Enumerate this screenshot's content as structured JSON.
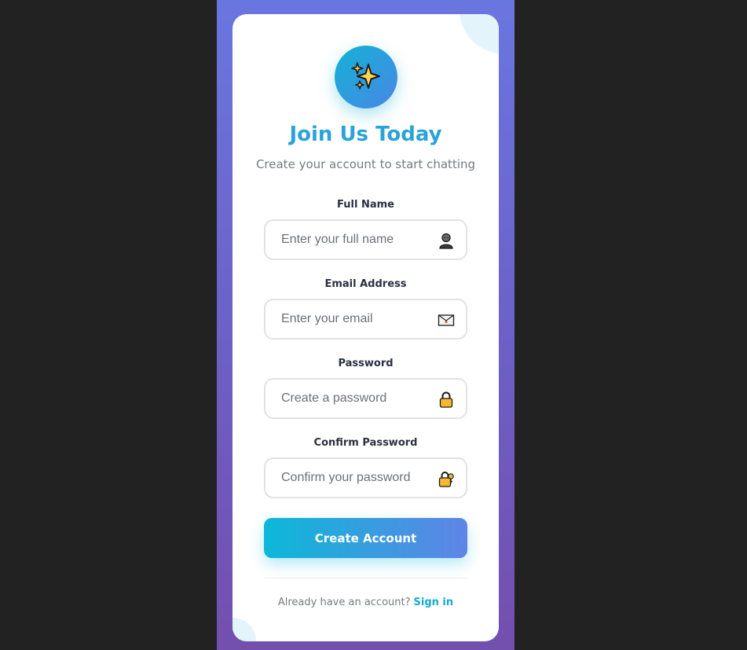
{
  "header": {
    "logo_icon": "sparkles-icon",
    "title": "Join Us Today",
    "subtitle": "Create your account to start chatting"
  },
  "form": {
    "full_name": {
      "label": "Full Name",
      "placeholder": "Enter your full name",
      "value": "",
      "icon": "person-icon"
    },
    "email": {
      "label": "Email Address",
      "placeholder": "Enter your email",
      "value": "",
      "icon": "envelope-icon"
    },
    "password": {
      "label": "Password",
      "placeholder": "Create a password",
      "value": "",
      "icon": "lock-icon"
    },
    "confirm_password": {
      "label": "Confirm Password",
      "placeholder": "Confirm your password",
      "value": "",
      "icon": "lock-key-icon"
    },
    "submit_label": "Create Account"
  },
  "footer": {
    "prompt": "Already have an account?",
    "link_label": "Sign in"
  },
  "colors": {
    "accent": "#2aa3da",
    "button_start": "#0cb8d8",
    "button_end": "#5f84e6",
    "link": "#14aad3",
    "backdrop": "#222222",
    "stage_top": "#6a76e0",
    "stage_bottom": "#734fae"
  }
}
